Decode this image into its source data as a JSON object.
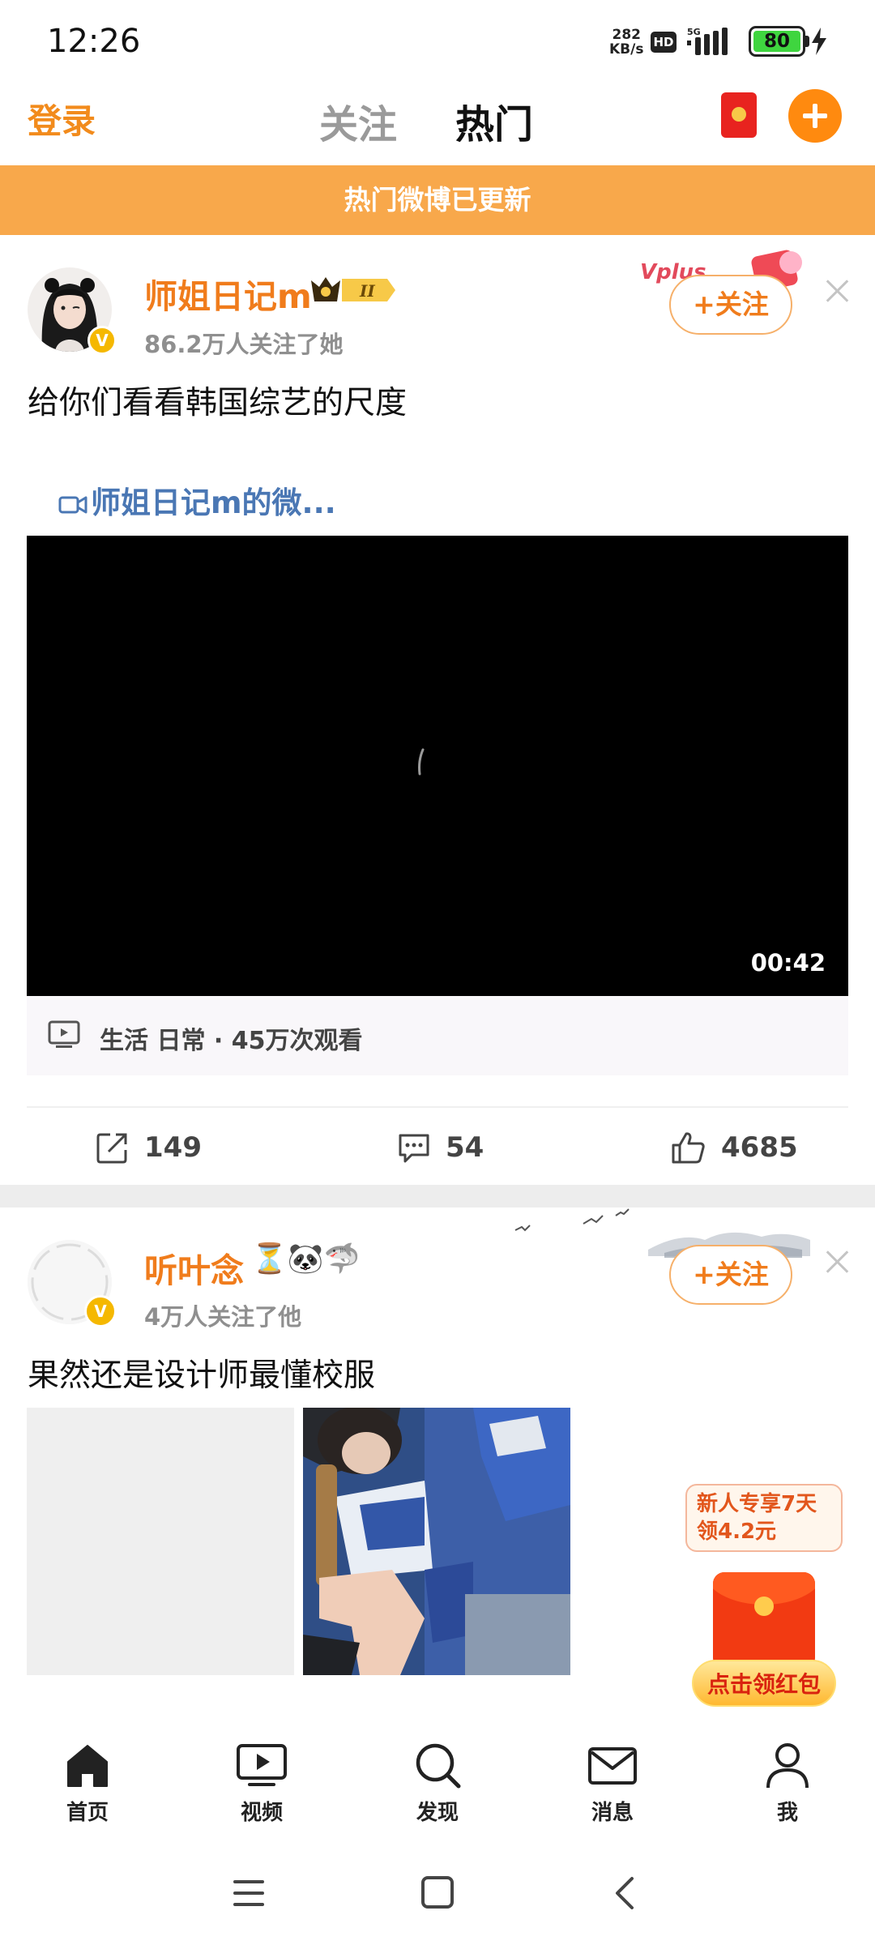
{
  "status_bar": {
    "time": "12:26",
    "net_speed_value": "282",
    "net_speed_unit": "KB/s",
    "hd_label": "HD",
    "network_type": "5G",
    "battery_level": "80"
  },
  "top_nav": {
    "login_label": "登录",
    "tabs": [
      {
        "label": "关注",
        "active": false
      },
      {
        "label": "热门",
        "active": true
      }
    ]
  },
  "update_banner": "热门微博已更新",
  "posts": [
    {
      "username": "师姐日记m",
      "badge_level": "II",
      "verified_label": "V",
      "followers": "86.2万人关注了她",
      "follow_label": "+关注",
      "text": "给你们看看韩国综艺的尺度",
      "video_link": "师姐日记m的微...",
      "video_duration": "00:42",
      "video_meta": "生活 日常 · 45万次观看",
      "actions": {
        "reposts": "149",
        "comments": "54",
        "likes": "4685"
      }
    },
    {
      "username": "听叶念",
      "emojis": "⏳🐼🦈",
      "verified_label": "V",
      "followers": "4万人关注了他",
      "follow_label": "+关注",
      "text": "果然还是设计师最懂校服"
    }
  ],
  "promo": {
    "bubble_line1": "新人专享7天",
    "bubble_line2": "领4.2元",
    "claim_label": "点击领红包"
  },
  "bottom_tabs": [
    {
      "label": "首页",
      "icon": "home-icon"
    },
    {
      "label": "视频",
      "icon": "video-icon"
    },
    {
      "label": "发现",
      "icon": "search-icon"
    },
    {
      "label": "消息",
      "icon": "mail-icon"
    },
    {
      "label": "我",
      "icon": "profile-icon"
    }
  ],
  "colors": {
    "accent_orange": "#f07c1c",
    "banner": "#f8a84b",
    "link_blue": "#4a77b4"
  }
}
